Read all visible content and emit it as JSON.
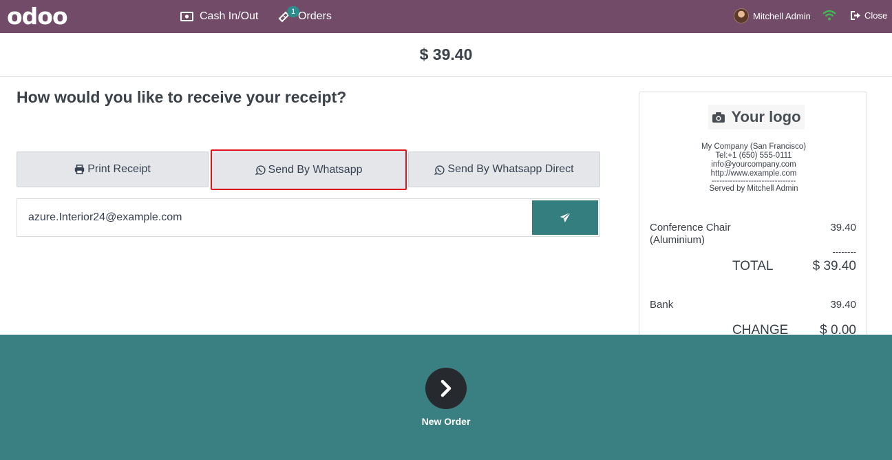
{
  "header": {
    "logo_text": "odoo",
    "nav": {
      "cash_label": "Cash In/Out",
      "orders_label": "Orders",
      "orders_badge": "1"
    },
    "user_name": "Mitchell Admin",
    "close_label": "Close",
    "colors": {
      "bar": "#714b67",
      "wifi": "#3fb950",
      "badge": "#2c8c8c"
    }
  },
  "payment": {
    "amount": "$ 39.40",
    "question": "How would you like to receive your receipt?",
    "buttons": {
      "print": "Print Receipt",
      "whatsapp": "Send By Whatsapp",
      "whatsapp_direct": "Send By Whatsapp Direct"
    },
    "email_value": "azure.Interior24@example.com",
    "send_icon": "paper-plane-icon"
  },
  "receipt": {
    "logo_text": "Your logo",
    "company_lines": [
      "My Company (San Francisco)",
      "Tel:+1 (650) 555-0111",
      "info@yourcompany.com",
      "http://www.example.com",
      "--------------------------------",
      "Served by Mitchell Admin"
    ],
    "line_item": {
      "name": "Conference Chair (Aluminium)",
      "price": "39.40"
    },
    "separator": "--------",
    "total_label": "TOTAL",
    "total_value": "$ 39.40",
    "payment_method": "Bank",
    "payment_value": "39.40",
    "change_label": "CHANGE",
    "change_value": "$ 0.00"
  },
  "footer": {
    "new_order_label": "New Order",
    "color": "#3a7f81"
  }
}
